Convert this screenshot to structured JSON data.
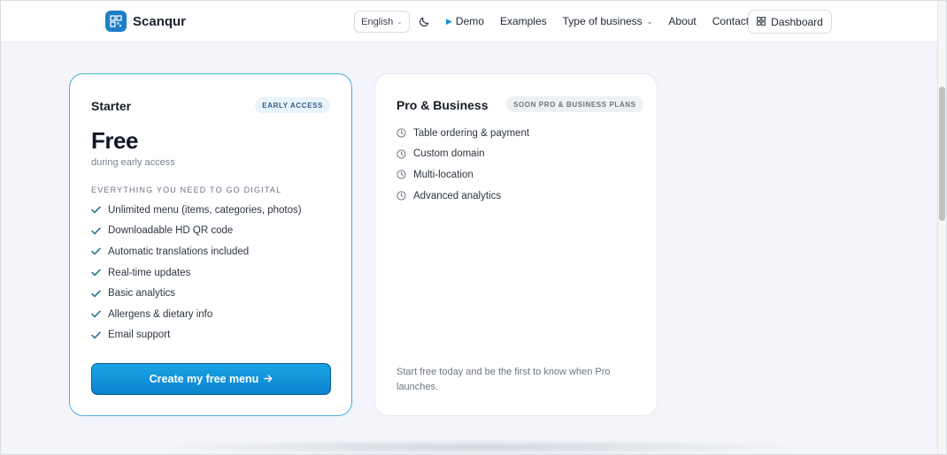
{
  "navbar": {
    "brand": "Scanqur",
    "language": "English",
    "links": {
      "demo": "Demo",
      "examples": "Examples",
      "business": "Type of business",
      "about": "About",
      "contact": "Contact"
    },
    "dashboard": "Dashboard"
  },
  "starter": {
    "title": "Starter",
    "badge": "EARLY ACCESS",
    "price": "Free",
    "price_note": "during early access",
    "section_label": "EVERYTHING YOU NEED TO GO DIGITAL",
    "features": [
      "Unlimited menu (items, categories, photos)",
      "Downloadable HD QR code",
      "Automatic translations included",
      "Real-time updates",
      "Basic analytics",
      "Allergens & dietary info",
      "Email support"
    ],
    "cta": "Create my free menu"
  },
  "pro": {
    "title": "Pro & Business",
    "badge": "SOON PRO & BUSINESS PLANS",
    "features": [
      "Table ordering & payment",
      "Custom domain",
      "Multi-location",
      "Advanced analytics"
    ],
    "footnote": "Start free today and be the first to know when Pro launches."
  },
  "colors": {
    "accent": "#1a8fd6",
    "check": "#1f6f86",
    "card_border_active": "#4aaddf"
  },
  "icons": {
    "brand": "qr-code-icon",
    "theme": "moon-icon",
    "dashboard": "grid-icon",
    "feature_included": "check-icon",
    "feature_soon": "clock-icon",
    "cta": "arrow-right-icon"
  }
}
